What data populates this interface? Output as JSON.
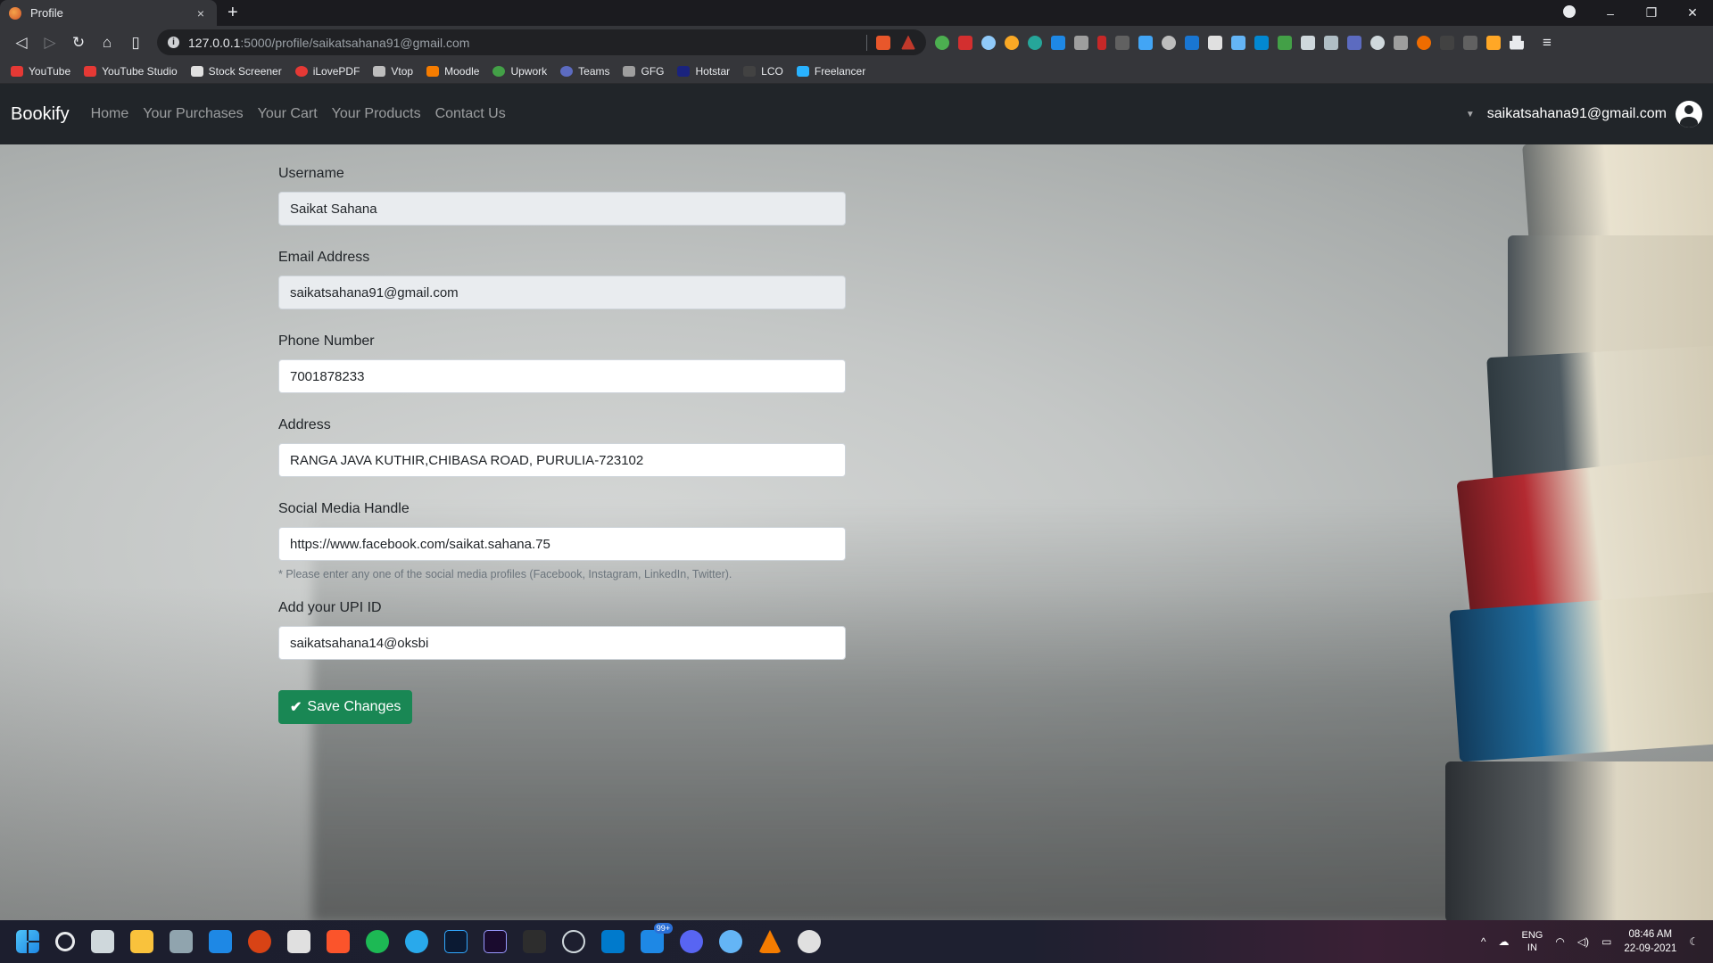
{
  "browser": {
    "tab_title": "Profile",
    "tab_close": "×",
    "new_tab": "+",
    "url_host": "127.0.0.1",
    "url_path": ":5000/profile/saikatsahana91@gmail.com",
    "bookmarks": [
      "YouTube",
      "YouTube Studio",
      "Stock Screener",
      "iLovePDF",
      "Vtop",
      "Moodle",
      "Upwork",
      "Teams",
      "GFG",
      "Hotstar",
      "LCO",
      "Freelancer"
    ],
    "window_controls": [
      "–",
      "❐",
      "✕"
    ]
  },
  "navbar": {
    "brand": "Bookify",
    "links": [
      "Home",
      "Your Purchases",
      "Your Cart",
      "Your Products",
      "Contact Us"
    ],
    "user_email": "saikatsahana91@gmail.com"
  },
  "form": {
    "username": {
      "label": "Username",
      "value": "Saikat Sahana"
    },
    "email": {
      "label": "Email Address",
      "value": "saikatsahana91@gmail.com"
    },
    "phone": {
      "label": "Phone Number",
      "value": "7001878233"
    },
    "address": {
      "label": "Address",
      "value": "RANGA JAVA KUTHIR,CHIBASA ROAD, PURULIA-723102"
    },
    "social": {
      "label": "Social Media Handle",
      "value": "https://www.facebook.com/saikat.sahana.75",
      "help": "* Please enter any one of the social media profiles (Facebook, Instagram, LinkedIn, Twitter)."
    },
    "upi": {
      "label": "Add your UPI ID",
      "value": "saikatsahana14@oksbi"
    },
    "save_label": "Save Changes"
  },
  "taskbar": {
    "badge": "99+",
    "lang_top": "ENG",
    "lang_bottom": "IN",
    "time": "08:46 AM",
    "date": "22-09-2021"
  },
  "colors": {
    "navbar_bg": "#212529",
    "save_button": "#198754",
    "readonly_field": "#e9ecef"
  }
}
